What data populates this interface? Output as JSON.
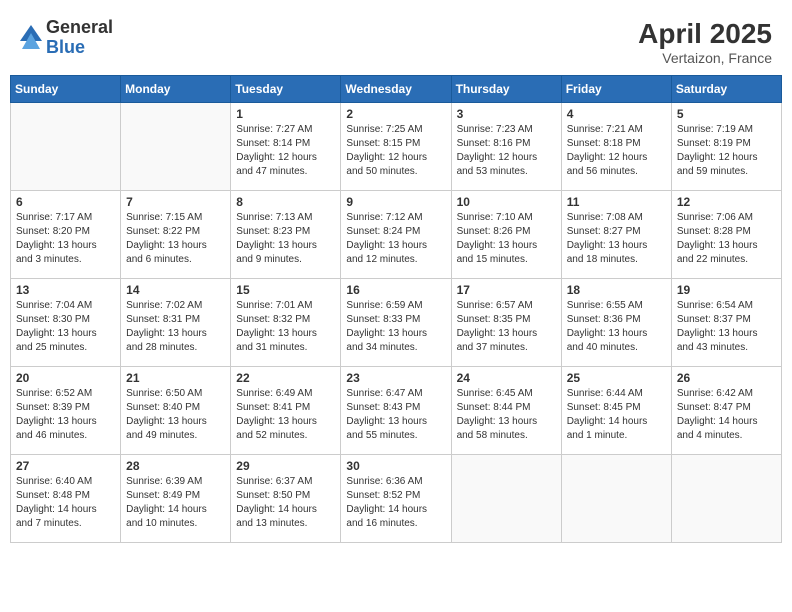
{
  "header": {
    "logo_general": "General",
    "logo_blue": "Blue",
    "month_year": "April 2025",
    "location": "Vertaizon, France"
  },
  "weekdays": [
    "Sunday",
    "Monday",
    "Tuesday",
    "Wednesday",
    "Thursday",
    "Friday",
    "Saturday"
  ],
  "weeks": [
    [
      {
        "day": "",
        "sunrise": "",
        "sunset": "",
        "daylight": ""
      },
      {
        "day": "",
        "sunrise": "",
        "sunset": "",
        "daylight": ""
      },
      {
        "day": "1",
        "sunrise": "Sunrise: 7:27 AM",
        "sunset": "Sunset: 8:14 PM",
        "daylight": "Daylight: 12 hours and 47 minutes."
      },
      {
        "day": "2",
        "sunrise": "Sunrise: 7:25 AM",
        "sunset": "Sunset: 8:15 PM",
        "daylight": "Daylight: 12 hours and 50 minutes."
      },
      {
        "day": "3",
        "sunrise": "Sunrise: 7:23 AM",
        "sunset": "Sunset: 8:16 PM",
        "daylight": "Daylight: 12 hours and 53 minutes."
      },
      {
        "day": "4",
        "sunrise": "Sunrise: 7:21 AM",
        "sunset": "Sunset: 8:18 PM",
        "daylight": "Daylight: 12 hours and 56 minutes."
      },
      {
        "day": "5",
        "sunrise": "Sunrise: 7:19 AM",
        "sunset": "Sunset: 8:19 PM",
        "daylight": "Daylight: 12 hours and 59 minutes."
      }
    ],
    [
      {
        "day": "6",
        "sunrise": "Sunrise: 7:17 AM",
        "sunset": "Sunset: 8:20 PM",
        "daylight": "Daylight: 13 hours and 3 minutes."
      },
      {
        "day": "7",
        "sunrise": "Sunrise: 7:15 AM",
        "sunset": "Sunset: 8:22 PM",
        "daylight": "Daylight: 13 hours and 6 minutes."
      },
      {
        "day": "8",
        "sunrise": "Sunrise: 7:13 AM",
        "sunset": "Sunset: 8:23 PM",
        "daylight": "Daylight: 13 hours and 9 minutes."
      },
      {
        "day": "9",
        "sunrise": "Sunrise: 7:12 AM",
        "sunset": "Sunset: 8:24 PM",
        "daylight": "Daylight: 13 hours and 12 minutes."
      },
      {
        "day": "10",
        "sunrise": "Sunrise: 7:10 AM",
        "sunset": "Sunset: 8:26 PM",
        "daylight": "Daylight: 13 hours and 15 minutes."
      },
      {
        "day": "11",
        "sunrise": "Sunrise: 7:08 AM",
        "sunset": "Sunset: 8:27 PM",
        "daylight": "Daylight: 13 hours and 18 minutes."
      },
      {
        "day": "12",
        "sunrise": "Sunrise: 7:06 AM",
        "sunset": "Sunset: 8:28 PM",
        "daylight": "Daylight: 13 hours and 22 minutes."
      }
    ],
    [
      {
        "day": "13",
        "sunrise": "Sunrise: 7:04 AM",
        "sunset": "Sunset: 8:30 PM",
        "daylight": "Daylight: 13 hours and 25 minutes."
      },
      {
        "day": "14",
        "sunrise": "Sunrise: 7:02 AM",
        "sunset": "Sunset: 8:31 PM",
        "daylight": "Daylight: 13 hours and 28 minutes."
      },
      {
        "day": "15",
        "sunrise": "Sunrise: 7:01 AM",
        "sunset": "Sunset: 8:32 PM",
        "daylight": "Daylight: 13 hours and 31 minutes."
      },
      {
        "day": "16",
        "sunrise": "Sunrise: 6:59 AM",
        "sunset": "Sunset: 8:33 PM",
        "daylight": "Daylight: 13 hours and 34 minutes."
      },
      {
        "day": "17",
        "sunrise": "Sunrise: 6:57 AM",
        "sunset": "Sunset: 8:35 PM",
        "daylight": "Daylight: 13 hours and 37 minutes."
      },
      {
        "day": "18",
        "sunrise": "Sunrise: 6:55 AM",
        "sunset": "Sunset: 8:36 PM",
        "daylight": "Daylight: 13 hours and 40 minutes."
      },
      {
        "day": "19",
        "sunrise": "Sunrise: 6:54 AM",
        "sunset": "Sunset: 8:37 PM",
        "daylight": "Daylight: 13 hours and 43 minutes."
      }
    ],
    [
      {
        "day": "20",
        "sunrise": "Sunrise: 6:52 AM",
        "sunset": "Sunset: 8:39 PM",
        "daylight": "Daylight: 13 hours and 46 minutes."
      },
      {
        "day": "21",
        "sunrise": "Sunrise: 6:50 AM",
        "sunset": "Sunset: 8:40 PM",
        "daylight": "Daylight: 13 hours and 49 minutes."
      },
      {
        "day": "22",
        "sunrise": "Sunrise: 6:49 AM",
        "sunset": "Sunset: 8:41 PM",
        "daylight": "Daylight: 13 hours and 52 minutes."
      },
      {
        "day": "23",
        "sunrise": "Sunrise: 6:47 AM",
        "sunset": "Sunset: 8:43 PM",
        "daylight": "Daylight: 13 hours and 55 minutes."
      },
      {
        "day": "24",
        "sunrise": "Sunrise: 6:45 AM",
        "sunset": "Sunset: 8:44 PM",
        "daylight": "Daylight: 13 hours and 58 minutes."
      },
      {
        "day": "25",
        "sunrise": "Sunrise: 6:44 AM",
        "sunset": "Sunset: 8:45 PM",
        "daylight": "Daylight: 14 hours and 1 minute."
      },
      {
        "day": "26",
        "sunrise": "Sunrise: 6:42 AM",
        "sunset": "Sunset: 8:47 PM",
        "daylight": "Daylight: 14 hours and 4 minutes."
      }
    ],
    [
      {
        "day": "27",
        "sunrise": "Sunrise: 6:40 AM",
        "sunset": "Sunset: 8:48 PM",
        "daylight": "Daylight: 14 hours and 7 minutes."
      },
      {
        "day": "28",
        "sunrise": "Sunrise: 6:39 AM",
        "sunset": "Sunset: 8:49 PM",
        "daylight": "Daylight: 14 hours and 10 minutes."
      },
      {
        "day": "29",
        "sunrise": "Sunrise: 6:37 AM",
        "sunset": "Sunset: 8:50 PM",
        "daylight": "Daylight: 14 hours and 13 minutes."
      },
      {
        "day": "30",
        "sunrise": "Sunrise: 6:36 AM",
        "sunset": "Sunset: 8:52 PM",
        "daylight": "Daylight: 14 hours and 16 minutes."
      },
      {
        "day": "",
        "sunrise": "",
        "sunset": "",
        "daylight": ""
      },
      {
        "day": "",
        "sunrise": "",
        "sunset": "",
        "daylight": ""
      },
      {
        "day": "",
        "sunrise": "",
        "sunset": "",
        "daylight": ""
      }
    ]
  ]
}
